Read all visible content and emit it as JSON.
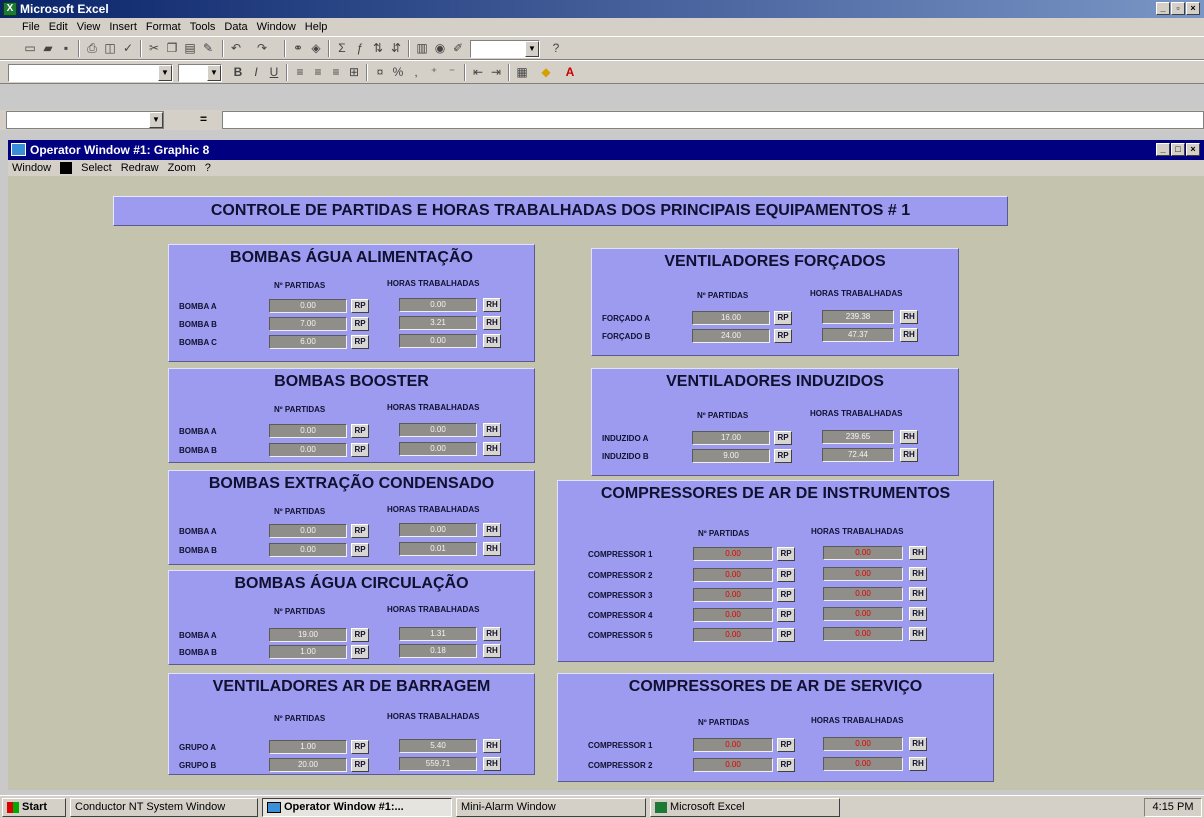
{
  "excel": {
    "title": "Microsoft Excel",
    "menu": [
      "File",
      "Edit",
      "View",
      "Insert",
      "Format",
      "Tools",
      "Data",
      "Window",
      "Help"
    ],
    "formula_eq": "="
  },
  "operator": {
    "title": "Operator Window #1: Graphic 8",
    "menu": [
      "Window",
      "Select",
      "Redraw",
      "Zoom",
      "?"
    ]
  },
  "banner": "CONTROLE DE PARTIDAS E HORAS TRABALHADAS DOS PRINCIPAIS EQUIPAMENTOS # 1",
  "labels": {
    "partidas": "Nº PARTIDAS",
    "horas": "HORAS TRABALHADAS",
    "rp": "RP",
    "rh": "RH"
  },
  "panels": [
    {
      "title": "BOMBAS ÁGUA ALIMENTAÇÃO",
      "rows": [
        {
          "label": "BOMBA A",
          "p": "0.00",
          "h": "0.00"
        },
        {
          "label": "BOMBA B",
          "p": "7.00",
          "h": "3.21"
        },
        {
          "label": "BOMBA C",
          "p": "6.00",
          "h": "0.00"
        }
      ]
    },
    {
      "title": "BOMBAS BOOSTER",
      "rows": [
        {
          "label": "BOMBA A",
          "p": "0.00",
          "h": "0.00"
        },
        {
          "label": "BOMBA B",
          "p": "0.00",
          "h": "0.00"
        }
      ]
    },
    {
      "title": "BOMBAS EXTRAÇÃO CONDENSADO",
      "rows": [
        {
          "label": "BOMBA A",
          "p": "0.00",
          "h": "0.00"
        },
        {
          "label": "BOMBA B",
          "p": "0.00",
          "h": "0.01"
        }
      ]
    },
    {
      "title": "BOMBAS ÁGUA CIRCULAÇÃO",
      "rows": [
        {
          "label": "BOMBA A",
          "p": "19.00",
          "h": "1.31"
        },
        {
          "label": "BOMBA B",
          "p": "1.00",
          "h": "0.18"
        }
      ]
    },
    {
      "title": "VENTILADORES AR DE BARRAGEM",
      "rows": [
        {
          "label": "GRUPO A",
          "p": "1.00",
          "h": "5.40"
        },
        {
          "label": "GRUPO B",
          "p": "20.00",
          "h": "559.71"
        }
      ]
    },
    {
      "title": "VENTILADORES FORÇADOS",
      "rows": [
        {
          "label": "FORÇADO A",
          "p": "16.00",
          "h": "239.38"
        },
        {
          "label": "FORÇADO B",
          "p": "24.00",
          "h": "47.37"
        }
      ]
    },
    {
      "title": "VENTILADORES INDUZIDOS",
      "rows": [
        {
          "label": "INDUZIDO A",
          "p": "17.00",
          "h": "239.65"
        },
        {
          "label": "INDUZIDO B",
          "p": "9.00",
          "h": "72.44"
        }
      ]
    },
    {
      "title": "COMPRESSORES DE AR DE INSTRUMENTOS",
      "rows": [
        {
          "label": "COMPRESSOR 1",
          "p": "0.00",
          "h": "0.00"
        },
        {
          "label": "COMPRESSOR 2",
          "p": "0.00",
          "h": "0.00"
        },
        {
          "label": "COMPRESSOR 3",
          "p": "0.00",
          "h": "0.00"
        },
        {
          "label": "COMPRESSOR 4",
          "p": "0.00",
          "h": "0.00"
        },
        {
          "label": "COMPRESSOR 5",
          "p": "0.00",
          "h": "0.00"
        }
      ]
    },
    {
      "title": "COMPRESSORES DE AR DE SERVIÇO",
      "rows": [
        {
          "label": "COMPRESSOR 1",
          "p": "0.00",
          "h": "0.00"
        },
        {
          "label": "COMPRESSOR 2",
          "p": "0.00",
          "h": "0.00"
        }
      ]
    }
  ],
  "taskbar": {
    "start": "Start",
    "items": [
      "Conductor NT System Window",
      "Operator Window #1:...",
      "Mini-Alarm Window",
      "Microsoft Excel"
    ],
    "clock": "4:15 PM"
  },
  "colors": {
    "panel": "#9d9bf0",
    "canvas": "#c4c3ad",
    "field": "#908e89",
    "alarm_text": "#e00000"
  }
}
